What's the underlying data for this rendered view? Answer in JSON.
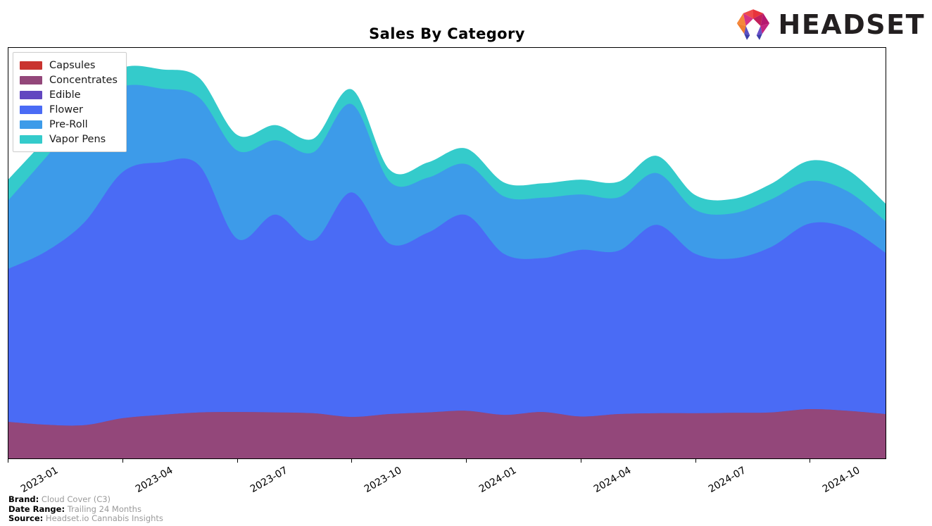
{
  "header": {
    "title": "Sales By Category",
    "logo_text": "HEADSET",
    "logo_icon": "headset-hexagon-logo"
  },
  "legend": {
    "position": "upper-left",
    "items": [
      {
        "label": "Capsules",
        "color": "#C9342F"
      },
      {
        "label": "Concentrates",
        "color": "#93477A"
      },
      {
        "label": "Edible",
        "color": "#6247C0"
      },
      {
        "label": "Flower",
        "color": "#4A6BF5"
      },
      {
        "label": "Pre-Roll",
        "color": "#3D9BE9"
      },
      {
        "label": "Vapor Pens",
        "color": "#34CBCB"
      }
    ]
  },
  "footer": {
    "rows": [
      {
        "key": "Brand:",
        "value": "Cloud Cover (C3)"
      },
      {
        "key": "Date Range:",
        "value": "Trailing 24 Months"
      },
      {
        "key": "Source:",
        "value": "Headset.io Cannabis Insights"
      }
    ]
  },
  "chart_data": {
    "type": "area",
    "stacked": true,
    "smoothing": "spline",
    "title": "Sales By Category",
    "xlabel": "",
    "ylabel": "",
    "grid": false,
    "legend_position": "upper left",
    "axis": {
      "x_tick_labels": [
        "2023-01",
        "2023-04",
        "2023-07",
        "2023-10",
        "2024-01",
        "2024-04",
        "2024-07",
        "2024-10"
      ],
      "x_tick_indices": [
        0,
        3,
        6,
        9,
        12,
        15,
        18,
        21
      ],
      "x_tick_rotation": -30,
      "y_tick_labels": [],
      "ylim": [
        0,
        100
      ]
    },
    "x": [
      "2023-01",
      "2023-02",
      "2023-03",
      "2023-04",
      "2023-05",
      "2023-06",
      "2023-07",
      "2023-08",
      "2023-09",
      "2023-10",
      "2023-11",
      "2023-12",
      "2024-01",
      "2024-02",
      "2024-03",
      "2024-04",
      "2024-05",
      "2024-06",
      "2024-07",
      "2024-08",
      "2024-09",
      "2024-10",
      "2024-11",
      "2024-12"
    ],
    "series": [
      {
        "name": "Capsules",
        "color": "#C9342F",
        "values": [
          0,
          0,
          0,
          0,
          0,
          0,
          0,
          0,
          0,
          0,
          0,
          0,
          0,
          0,
          0,
          0,
          0,
          0,
          0,
          0,
          0,
          0,
          0,
          0
        ]
      },
      {
        "name": "Concentrates",
        "color": "#93477A",
        "values": [
          8.9,
          8.2,
          8.1,
          9.8,
          10.6,
          11.2,
          11.3,
          11.2,
          11.0,
          10.1,
          10.8,
          11.2,
          11.6,
          10.6,
          11.3,
          10.2,
          10.8,
          11.0,
          11.0,
          11.1,
          11.2,
          12.0,
          11.6,
          10.8
        ]
      },
      {
        "name": "Edible",
        "color": "#6247C0",
        "values": [
          0,
          0,
          0,
          0,
          0,
          0,
          0,
          0,
          0,
          0,
          0,
          0,
          0,
          0,
          0,
          0,
          0,
          0,
          0,
          0,
          0,
          0,
          0,
          0
        ]
      },
      {
        "name": "Flower",
        "color": "#4A6BF5",
        "values": [
          37.3,
          42.3,
          49.5,
          60.0,
          61.5,
          60.2,
          42.2,
          48.2,
          42.1,
          54.7,
          41.5,
          43.8,
          47.7,
          39.2,
          37.5,
          40.6,
          39.8,
          45.9,
          38.9,
          37.6,
          40.3,
          45.2,
          44.5,
          39.3
        ]
      },
      {
        "name": "Pre-Roll",
        "color": "#3D9BE9",
        "values": [
          16.7,
          23.0,
          26.8,
          20.8,
          18.0,
          16.5,
          21.5,
          18.1,
          21.5,
          21.5,
          15.1,
          13.4,
          12.4,
          14.0,
          14.7,
          13.5,
          13.0,
          12.6,
          10.7,
          11.0,
          11.6,
          10.4,
          9.0,
          7.7
        ]
      },
      {
        "name": "Vapor Pens",
        "color": "#34CBCB",
        "values": [
          5.1,
          4.5,
          4.3,
          4.6,
          4.7,
          4.8,
          3.8,
          3.7,
          3.3,
          3.6,
          2.9,
          3.7,
          3.8,
          3.4,
          3.5,
          3.6,
          3.8,
          4.2,
          3.6,
          3.5,
          3.8,
          4.9,
          5.2,
          4.3
        ]
      }
    ]
  }
}
